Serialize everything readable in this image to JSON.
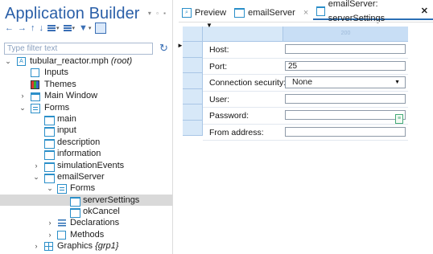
{
  "app": {
    "title": "Application Builder"
  },
  "filter": {
    "placeholder": "Type filter text"
  },
  "tree": {
    "root": "tubular_reactor.mph",
    "root_suffix": "(root)",
    "items": {
      "inputs": "Inputs",
      "themes": "Themes",
      "main_window": "Main Window",
      "forms": "Forms",
      "main": "main",
      "input": "input",
      "description": "description",
      "information": "information",
      "simulation_events": "simulationEvents",
      "email_server": "emailServer",
      "email_forms": "Forms",
      "server_settings": "serverSettings",
      "ok_cancel": "okCancel",
      "declarations": "Declarations",
      "methods": "Methods",
      "graphics": "Graphics",
      "graphics_suffix": "{grp1}"
    }
  },
  "tabs": [
    {
      "label": "Preview"
    },
    {
      "label": "emailServer",
      "close": "×"
    },
    {
      "label": "emailServer: serverSettings",
      "close": "✕"
    }
  ],
  "form_editor": {
    "column_width_label": "200",
    "fields": {
      "host": {
        "label": "Host:",
        "value": ""
      },
      "port": {
        "label": "Port:",
        "value": "25"
      },
      "security": {
        "label": "Connection security:",
        "value": "None"
      },
      "user": {
        "label": "User:",
        "value": ""
      },
      "password": {
        "label": "Password:",
        "value": ""
      },
      "from": {
        "label": "From address:",
        "value": ""
      }
    }
  },
  "colors": {
    "accent": "#2b6fb5",
    "grid_header": "#d7e8f8",
    "selection": "#d9d9d9"
  }
}
